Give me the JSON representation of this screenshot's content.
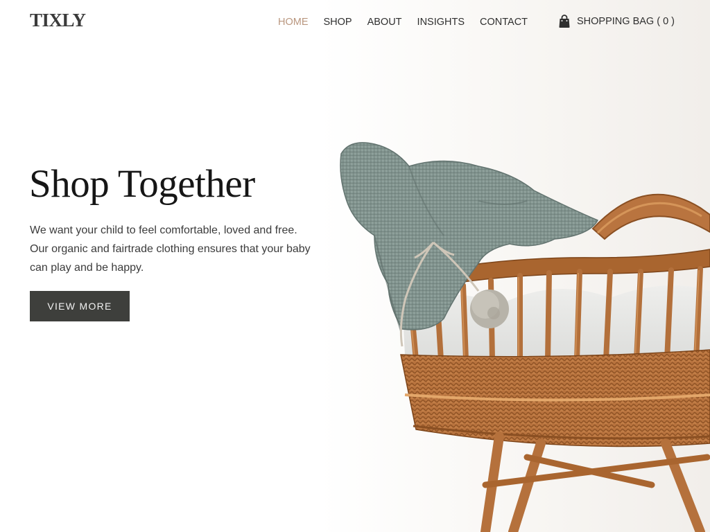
{
  "header": {
    "logo": "TIXLY",
    "nav": [
      {
        "label": "HOME",
        "active": true
      },
      {
        "label": "SHOP",
        "active": false
      },
      {
        "label": "ABOUT",
        "active": false
      },
      {
        "label": "INSIGHTS",
        "active": false
      },
      {
        "label": "CONTACT",
        "active": false
      }
    ],
    "cart_label": "SHOPPING BAG ( 0 )",
    "cart_icon": "shopping-bag-icon"
  },
  "hero": {
    "title": "Shop Together",
    "body": "We want your child to feel comfortable, loved and free. Our organic and fairtrade clothing ensures that your baby can play and be happy.",
    "cta_label": "VIEW MORE",
    "image": "knitted-baby-bonnet-on-wicker-bassinet"
  },
  "colors": {
    "accent": "#b9967e",
    "button_bg": "#3e3f3c",
    "text_dark": "#161616",
    "wicker": "#b8733e",
    "knit": "#7f938f"
  }
}
